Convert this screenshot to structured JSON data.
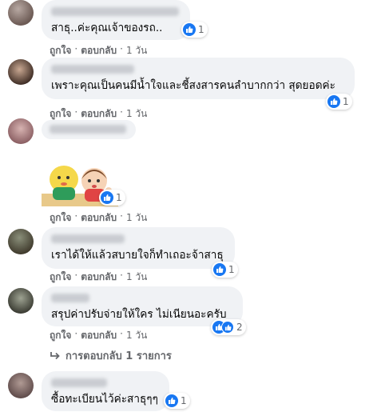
{
  "comments": [
    {
      "text": "สาธุ..ค่ะคุณเจ้าของรถ..",
      "reaction_count": "1",
      "actions": {
        "like": "ถูกใจ",
        "reply": "ตอบกลับ",
        "time": "1 วัน"
      }
    },
    {
      "text": "เพราะคุณเป็นคนมีน้ำใจและชี้สงสารคนลำบากกว่า สุดยอดค่ะ",
      "reaction_count": "1",
      "actions": {
        "like": "ถูกใจ",
        "reply": "ตอบกลับ",
        "time": "1 วัน"
      }
    },
    {
      "text": "",
      "reaction_count": "1",
      "actions": {
        "like": "ถูกใจ",
        "reply": "ตอบกลับ",
        "time": "1 วัน"
      }
    },
    {
      "text": "เราได้ให้แล้วสบายใจก็ทำเถอะจ้าสาธุ",
      "reaction_count": "1",
      "actions": {
        "like": "ถูกใจ",
        "reply": "ตอบกลับ",
        "time": "1 วัน"
      }
    },
    {
      "text": "สรุปค่าปรับจ่ายให้ใคร ไม่เนียนอะครับ",
      "reaction_count": "2",
      "actions": {
        "like": "ถูกใจ",
        "reply": "ตอบกลับ",
        "time": "1 วัน"
      },
      "replies_link": "การตอบกลับ 1 รายการ"
    },
    {
      "text": "ซื้อทะเบียนไว้ค่ะสาธุๆๆ",
      "reaction_count": "1"
    }
  ],
  "separator": "·",
  "colors": {
    "like_blue": "#1877f2",
    "bubble_bg": "#f0f2f5",
    "muted": "#65676b"
  }
}
